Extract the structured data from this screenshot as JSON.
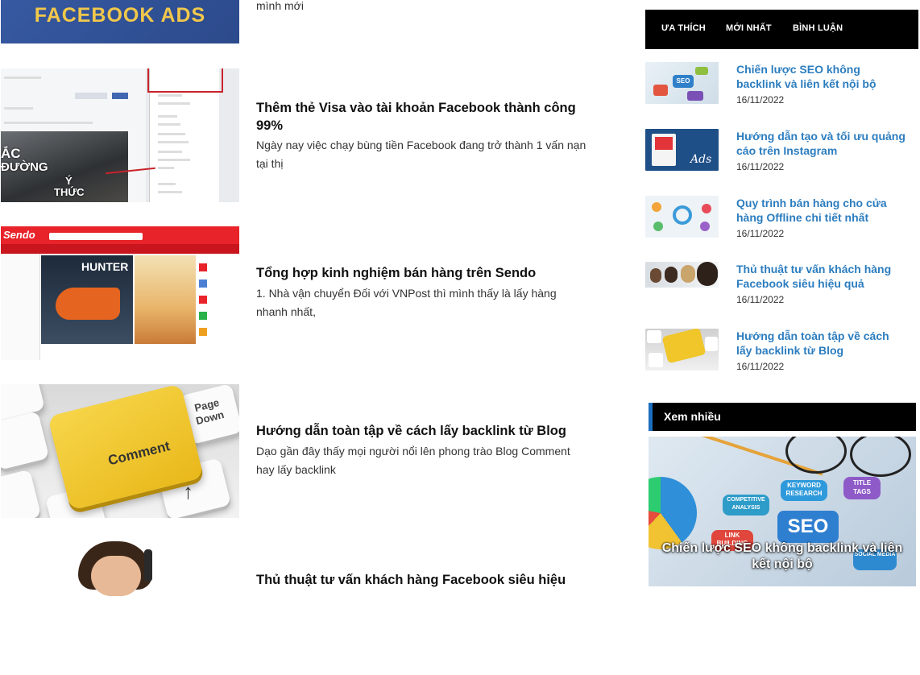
{
  "posts": [
    {
      "excerpt_end": "mình mới",
      "thumb_text": "FACEBOOK ADS"
    },
    {
      "title": "Thêm thẻ Visa vào tài khoản Facebook thành công 99%",
      "excerpt": "Ngày nay việc chạy bùng tiền Facebook đang trở thành 1 vấn nạn tại thị",
      "thumb_overlay": [
        "ẮC",
        "ĐƯỜNG",
        "Ý",
        "THỨC"
      ]
    },
    {
      "title": "Tổng hợp kinh nghiệm bán hàng trên Sendo",
      "excerpt": "1. Nhà vận chuyển Đối với VNPost thì mình thấy là lấy hàng nhanh nhất,",
      "thumb_brand": "Sendo",
      "thumb_hero": "HUNTER"
    },
    {
      "title": "Hướng dẫn toàn tập về cách lấy backlink từ Blog",
      "excerpt": "Dạo gần đây thấy mọi người nổi lên phong trào Blog Comment hay lấy backlink",
      "thumb_key": "Comment",
      "thumb_page": "Page Down"
    },
    {
      "title": "Thủ thuật tư vấn khách hàng Facebook siêu hiệu"
    }
  ],
  "sidebar": {
    "tabs": [
      "ƯA THÍCH",
      "MỚI NHẤT",
      "BÌNH LUẬN"
    ],
    "items": [
      {
        "title": "Chiến lược SEO không backlink và liên kết nội bộ",
        "date": "16/11/2022",
        "icon": "seo-image"
      },
      {
        "title": "Hướng dẫn tạo và tối ưu quảng cáo trên Instagram",
        "date": "16/11/2022",
        "icon": "instagram-ads-image"
      },
      {
        "title": "Quy trình bán hàng cho cửa hàng Offline chi tiết nhất",
        "date": "16/11/2022",
        "icon": "offline-store-image"
      },
      {
        "title": "Thủ thuật tư vấn khách hàng Facebook siêu hiệu quả",
        "date": "16/11/2022",
        "icon": "call-center-image"
      },
      {
        "title": "Hướng dẫn toàn tập về cách lấy backlink từ Blog",
        "date": "16/11/2022",
        "icon": "keyboard-comment-image"
      }
    ],
    "most_viewed": {
      "heading": "Xem nhiều",
      "featured_title": "Chiến lược SEO không backlink và liên kết nội bộ",
      "bubbles": [
        "SEO",
        "KEYWORD RESEARCH",
        "TITLE TAGS",
        "LINK BUILDING",
        "COMPETITIVE ANALYSIS",
        "SOCIAL MEDIA"
      ]
    }
  },
  "colors": {
    "link": "#2c7dbf",
    "tab_bg": "#000000",
    "accent_bar": "#1d6fbf"
  }
}
